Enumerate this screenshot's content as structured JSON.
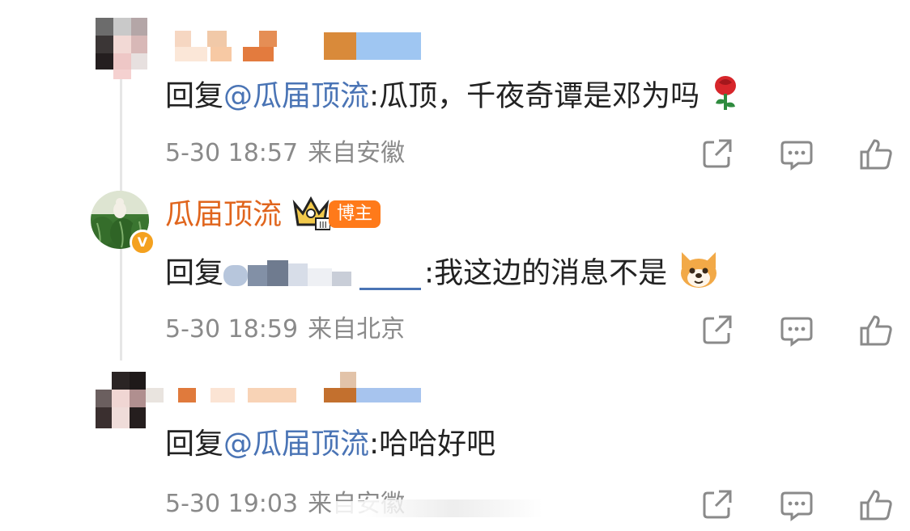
{
  "comments": [
    {
      "reply_prefix": "回复",
      "mention": "@瓜届顶流",
      "text": ":瓜顶，千夜奇谭是邓为吗",
      "emoji": "rose-emoji",
      "time": "5-30 18:57",
      "location": "来自安徽"
    },
    {
      "author": "瓜届顶流",
      "badge": "博主",
      "reply_prefix": "回复",
      "text": ":我这边的消息不是",
      "emoji": "dog-face-emoji",
      "time": "5-30 18:59",
      "location": "来自北京"
    },
    {
      "reply_prefix": "回复",
      "mention": "@瓜届顶流",
      "text": ":哈哈好吧",
      "time": "5-30 19:03",
      "location": "来自安徽"
    }
  ],
  "icons": {
    "share": "share-icon",
    "comment": "comment-icon",
    "like": "thumbs-up-icon"
  },
  "colors": {
    "mention": "#4a74b5",
    "author": "#e0651d",
    "badge": "#ff7a1a",
    "meta": "#8a8a8a"
  }
}
